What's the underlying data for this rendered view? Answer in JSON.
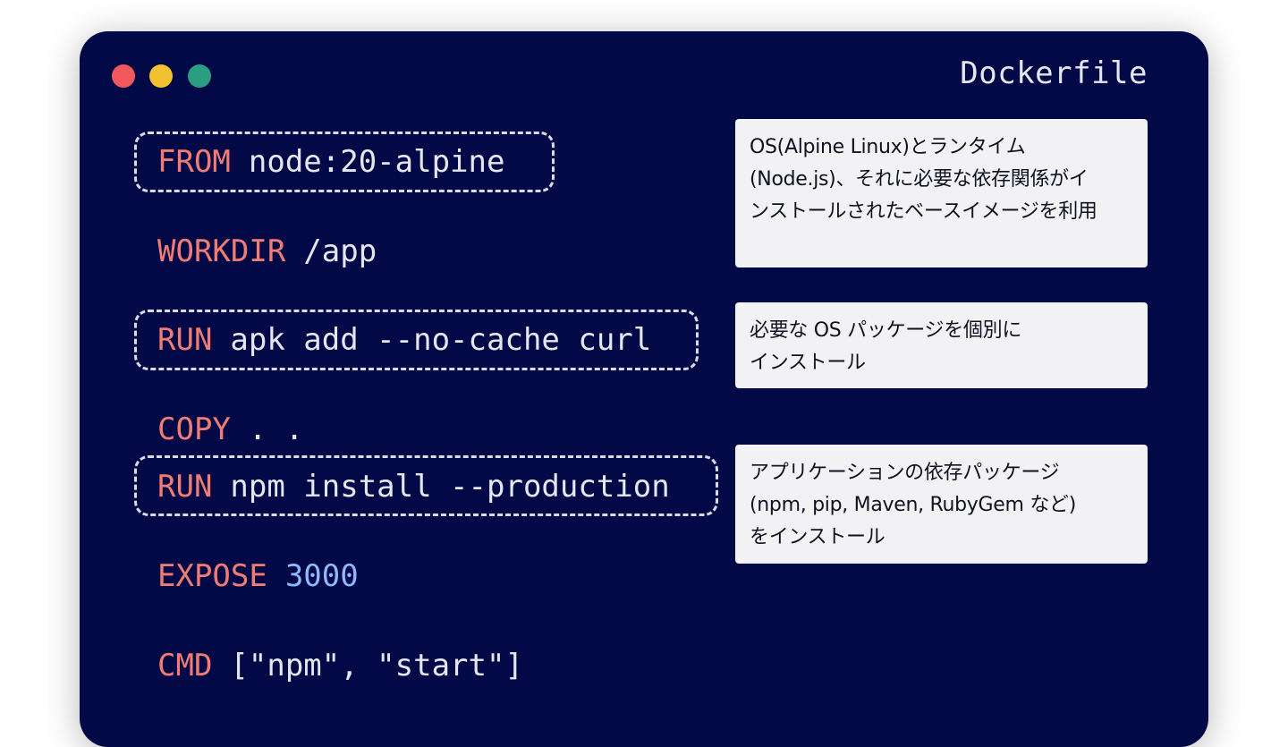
{
  "window": {
    "title": "Dockerfile",
    "dots": {
      "red": "#f0585e",
      "yellow": "#f2c230",
      "green": "#2a9d82"
    }
  },
  "colors": {
    "background": "#030846",
    "keyword": "#f07d73",
    "text": "#e5e7f0",
    "number": "#8fb8ff",
    "note_bg": "#f2f2f5",
    "note_text": "#10131f"
  },
  "code": {
    "line1": {
      "keyword": "FROM",
      "arg": "node:20-alpine"
    },
    "line2": {
      "keyword": "WORKDIR",
      "arg": "/app"
    },
    "line3": {
      "keyword": "RUN",
      "arg": "apk add --no-cache curl"
    },
    "line4": {
      "keyword": "COPY",
      "arg": ". ."
    },
    "line5": {
      "keyword": "RUN",
      "arg": "npm install --production"
    },
    "line6": {
      "keyword": "EXPOSE",
      "arg": "3000"
    },
    "line7": {
      "keyword": "CMD",
      "arg": "[\"npm\", \"start\"]"
    }
  },
  "notes": {
    "base_image": [
      "OS(Alpine Linux)とランタイム",
      "(Node.js)、それに必要な依存関係がイ",
      "ンストールされたベースイメージを利用"
    ],
    "os_packages": [
      "必要な OS パッケージを個別に",
      "インストール"
    ],
    "app_deps": [
      "アプリケーションの依存パッケージ",
      "(npm, pip, Maven, RubyGem など)",
      "をインストール"
    ]
  }
}
